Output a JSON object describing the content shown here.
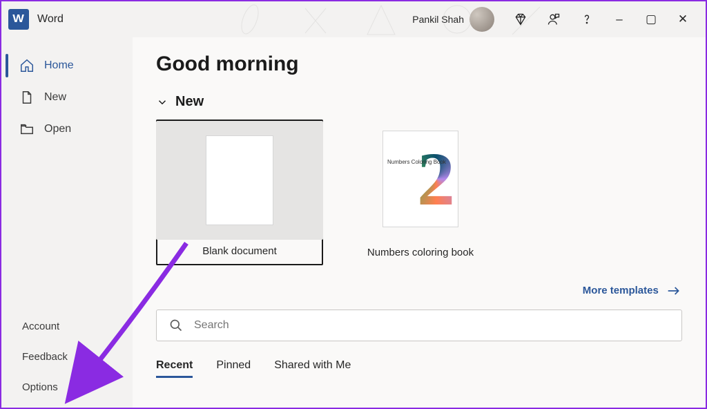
{
  "app": {
    "title": "Word",
    "logo_letter": "W"
  },
  "user": {
    "name": "Pankil Shah"
  },
  "window_controls": {
    "minimize": "–",
    "restore": "▢",
    "close": "✕"
  },
  "sidebar": {
    "items": [
      {
        "label": "Home"
      },
      {
        "label": "New"
      },
      {
        "label": "Open"
      }
    ],
    "lower": [
      {
        "label": "Account"
      },
      {
        "label": "Feedback"
      },
      {
        "label": "Options"
      }
    ]
  },
  "main": {
    "greeting": "Good morning",
    "section_new": "New",
    "templates": [
      {
        "label": "Blank document"
      },
      {
        "label": "Numbers coloring book",
        "thumb_side_text": "Numbers Coloring Book"
      }
    ],
    "more_templates": "More templates",
    "search_placeholder": "Search",
    "tabs": [
      {
        "label": "Recent"
      },
      {
        "label": "Pinned"
      },
      {
        "label": "Shared with Me"
      }
    ]
  }
}
